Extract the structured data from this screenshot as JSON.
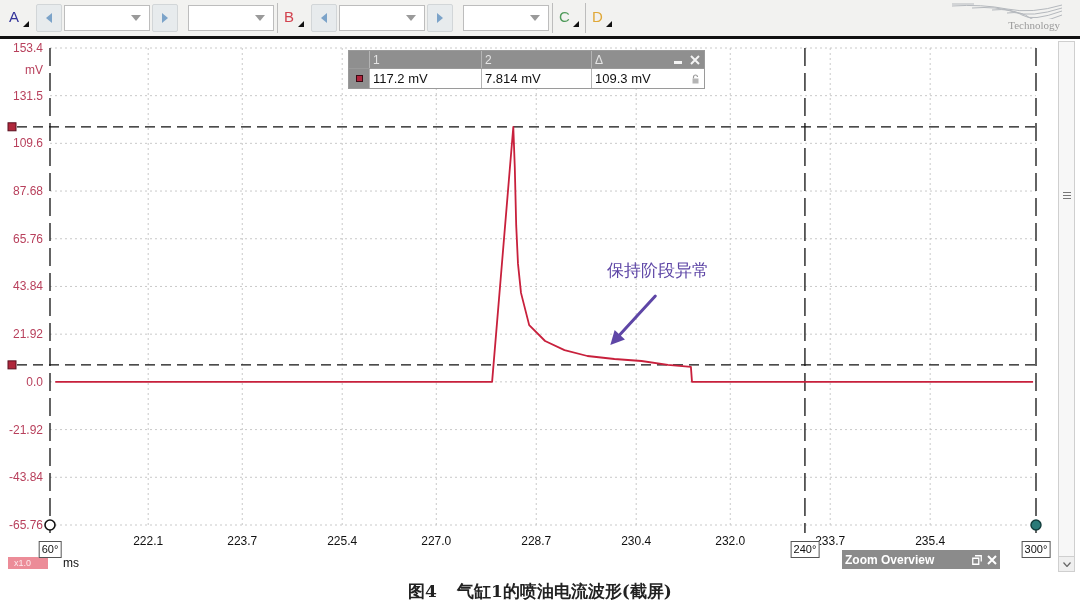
{
  "toolbar": {
    "items": [
      {
        "kind": "channel",
        "label": "A",
        "color": "#34349a"
      },
      {
        "kind": "prev"
      },
      {
        "kind": "dropdown"
      },
      {
        "kind": "next"
      },
      {
        "kind": "dropdown"
      },
      {
        "kind": "channel",
        "label": "B",
        "color": "#d2424e"
      },
      {
        "kind": "prev"
      },
      {
        "kind": "dropdown"
      },
      {
        "kind": "next"
      },
      {
        "kind": "dropdown"
      },
      {
        "kind": "channel",
        "label": "C",
        "color": "#4f9a5a"
      },
      {
        "kind": "channel",
        "label": "D",
        "color": "#e0a838"
      }
    ],
    "logo": {
      "text": "Technology"
    }
  },
  "scope": {
    "ruler_table": {
      "columns": [
        "1",
        "2",
        "Δ"
      ],
      "rows": [
        {
          "color": "#b0243c",
          "values": [
            "117.2 mV",
            "7.814 mV",
            "109.3 mV"
          ]
        }
      ]
    },
    "chart_data": {
      "type": "line",
      "xlabel": "ms",
      "ylabel": "mV",
      "grid": true,
      "xlim": [
        220.43,
        237.2
      ],
      "ylim": [
        -65.76,
        153.4
      ],
      "xticks": [
        222.1,
        223.7,
        225.4,
        {
          "value": 227,
          "label": "227.0"
        },
        228.7,
        230.4,
        {
          "value": 232,
          "label": "232.0"
        },
        233.7,
        235.4
      ],
      "yticks": [
        153.4,
        131.5,
        109.6,
        87.68,
        65.76,
        43.84,
        21.92,
        {
          "value": 0,
          "label": "0.0"
        },
        -21.92,
        -43.84,
        -65.76
      ],
      "x": [
        220.52,
        227.95,
        228.31,
        228.335,
        228.36,
        228.39,
        228.44,
        228.58,
        228.85,
        229.18,
        229.57,
        230.03,
        230.49,
        230.94,
        231.33,
        231.35,
        237.15
      ],
      "series": [
        {
          "color": "#c8203c",
          "values": [
            0,
            0,
            117.1,
            98.4,
            71.9,
            54.2,
            40.9,
            26.1,
            18.8,
            14.6,
            11.9,
            10.5,
            9.6,
            7.8,
            6.9,
            0,
            0
          ]
        }
      ],
      "ref_lines": [
        {
          "axis": "y",
          "value": 117.2
        },
        {
          "axis": "y",
          "value": 7.814
        },
        {
          "axis": "x",
          "value": 220.43
        },
        {
          "axis": "x",
          "value": 233.27
        },
        {
          "axis": "x",
          "value": 237.2
        }
      ],
      "annotations": [
        "保持阶段异常"
      ]
    },
    "rotation_rulers": [
      {
        "kind": "hollow",
        "label": "60°"
      },
      {
        "kind": "plain",
        "label": "240°"
      },
      {
        "kind": "filled",
        "label": "300°"
      }
    ],
    "zoom_factor": "x1.0",
    "zoom_overview": {
      "title": "Zoom Overview"
    }
  },
  "caption": {
    "label": "图4",
    "text": "气缸1的喷油电流波形(截屏)"
  }
}
